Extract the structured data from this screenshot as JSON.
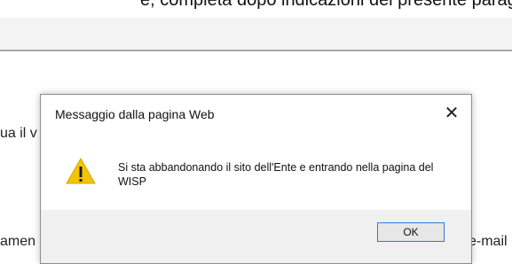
{
  "background": {
    "top_line": "e, completa dopo indicazioni del presente paragrafo",
    "left_text_1": "ua il v",
    "left_text_2": "amen",
    "right_text": "e-mail"
  },
  "dialog": {
    "title": "Messaggio dalla pagina Web",
    "close_symbol": "✕",
    "icon": "warning-icon",
    "message": "Si sta abbandonando il sito dell'Ente e entrando nella pagina del WISP",
    "ok_label": "OK"
  },
  "colors": {
    "warning_fill": "#f5c400",
    "ok_border": "#2f7bd6",
    "footer_bg": "#f0f0f0"
  }
}
